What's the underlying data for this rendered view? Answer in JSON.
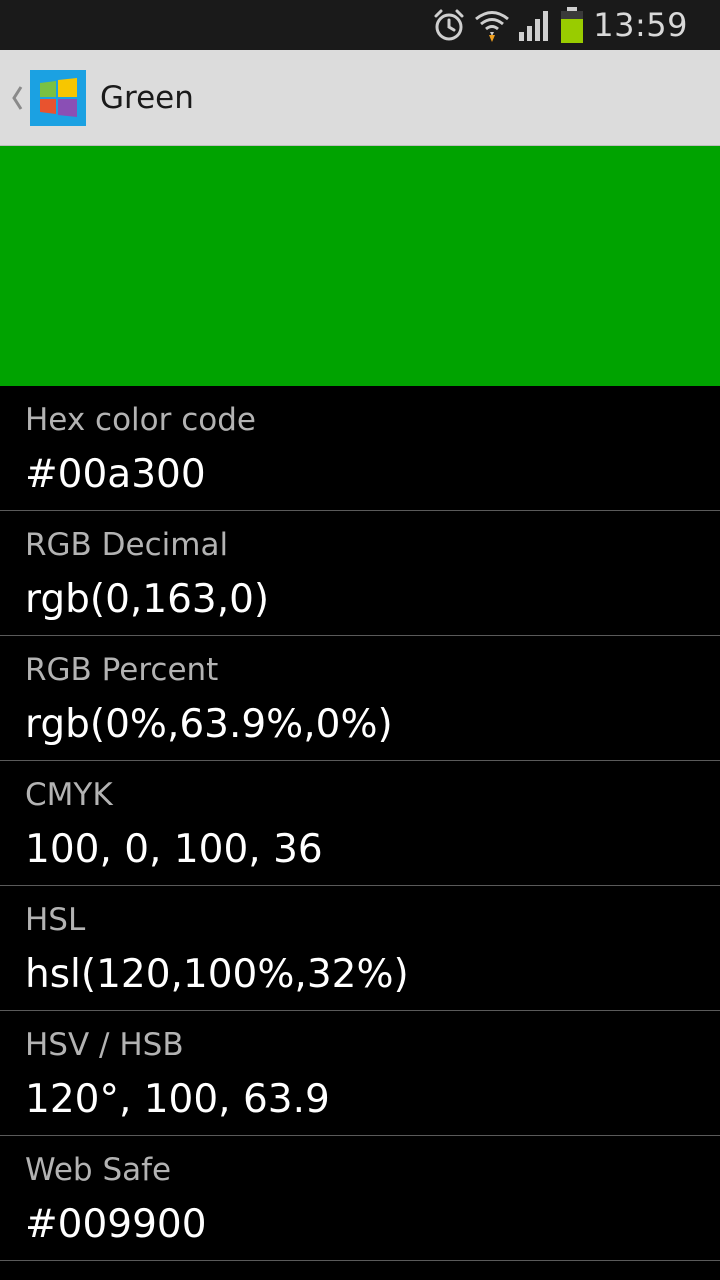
{
  "status_bar": {
    "time": "13:59",
    "icons": [
      "alarm-clock-icon",
      "wifi-icon",
      "signal-icon",
      "battery-icon"
    ],
    "battery_color": "#99cc00"
  },
  "action_bar": {
    "title": "Green",
    "icon": "windows-logo-icon"
  },
  "swatch": {
    "color": "#00a300"
  },
  "rows": [
    {
      "label": "Hex color code",
      "value": "#00a300"
    },
    {
      "label": "RGB Decimal",
      "value": "rgb(0,163,0)"
    },
    {
      "label": "RGB Percent",
      "value": "rgb(0%,63.9%,0%)"
    },
    {
      "label": "CMYK",
      "value": "100, 0, 100, 36"
    },
    {
      "label": "HSL",
      "value": "hsl(120,100%,32%)"
    },
    {
      "label": "HSV / HSB",
      "value": "120°, 100, 63.9"
    },
    {
      "label": "Web Safe",
      "value": "#009900"
    }
  ]
}
